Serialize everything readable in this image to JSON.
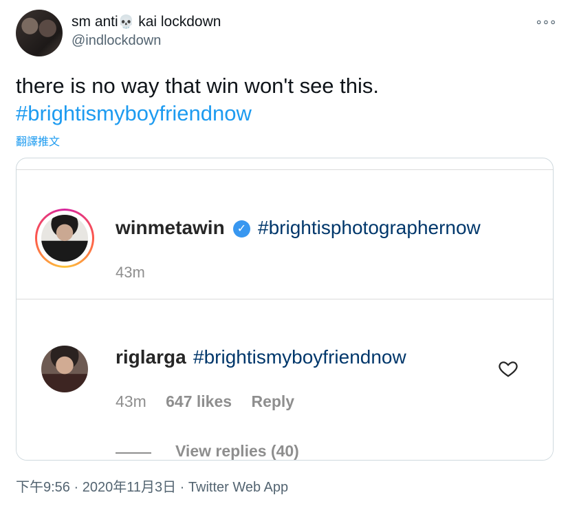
{
  "tweet": {
    "display_name": "sm anti",
    "display_name_skull": "💀",
    "display_name_suffix": " kai lockdown",
    "handle": "@indlockdown",
    "more_icon": "more-dots-icon",
    "text_line1": "there is no way that win won't see this.",
    "hashtag": "#brightismyboyfriendnow",
    "translate": "翻譯推文"
  },
  "media": {
    "post": {
      "username": "winmetawin",
      "verified_mark": "✓",
      "caption": "#brightisphotographernow",
      "time": "43m"
    },
    "comment": {
      "username": "riglarga",
      "text": "#brightismyboyfriendnow",
      "time": "43m",
      "likes": "647 likes",
      "reply": "Reply",
      "view_replies": "View replies (40)"
    }
  },
  "footer": {
    "time": "下午9:56",
    "sep1": " · ",
    "date": "2020年11月3日",
    "sep2": " · ",
    "app": "Twitter Web App"
  },
  "colors": {
    "link": "#1d9bf0",
    "ig_link": "#00376b",
    "muted": "#8e8e8e"
  }
}
